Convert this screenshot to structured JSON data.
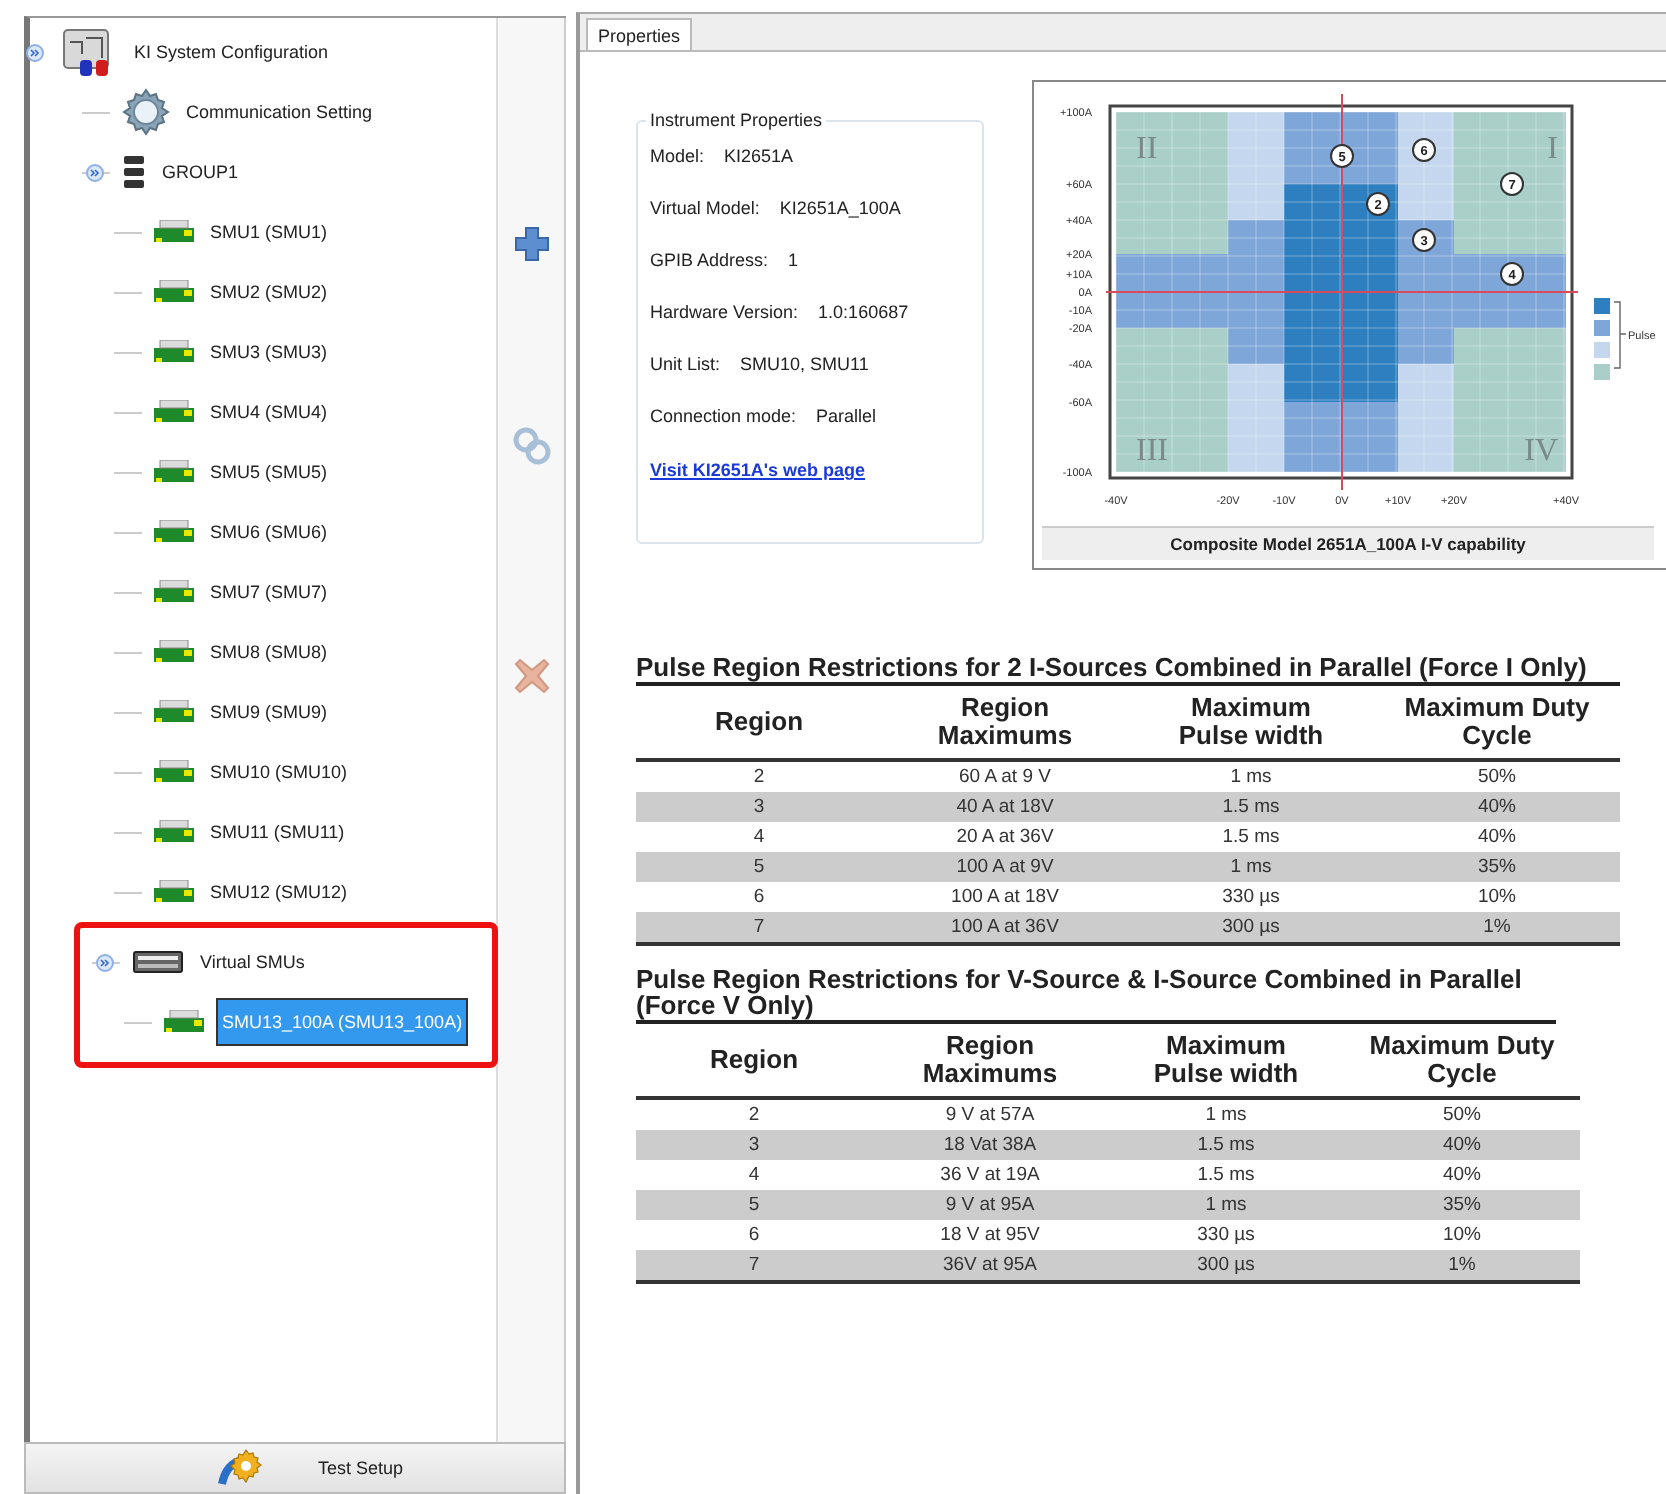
{
  "tree": [
    {
      "label": "KI System Configuration",
      "kind": "system",
      "expanded": true,
      "selected": false,
      "children": [
        {
          "label": "Communication Setting",
          "kind": "gear",
          "selected": false
        },
        {
          "label": "GROUP1",
          "kind": "group",
          "expanded": true,
          "selected": false,
          "children": [
            {
              "label": "SMU1 (SMU1)",
              "kind": "smu",
              "selected": false
            },
            {
              "label": "SMU2 (SMU2)",
              "kind": "smu",
              "selected": false
            },
            {
              "label": "SMU3 (SMU3)",
              "kind": "smu",
              "selected": false
            },
            {
              "label": "SMU4 (SMU4)",
              "kind": "smu",
              "selected": false
            },
            {
              "label": "SMU5 (SMU5)",
              "kind": "smu",
              "selected": false
            },
            {
              "label": "SMU6 (SMU6)",
              "kind": "smu",
              "selected": false
            },
            {
              "label": "SMU7 (SMU7)",
              "kind": "smu",
              "selected": false
            },
            {
              "label": "SMU8 (SMU8)",
              "kind": "smu",
              "selected": false
            },
            {
              "label": "SMU9 (SMU9)",
              "kind": "smu",
              "selected": false
            },
            {
              "label": "SMU10 (SMU10)",
              "kind": "smu",
              "selected": false
            },
            {
              "label": "SMU11 (SMU11)",
              "kind": "smu",
              "selected": false
            },
            {
              "label": "SMU12 (SMU12)",
              "kind": "smu",
              "selected": false
            }
          ]
        },
        {
          "label": "Virtual SMUs",
          "kind": "virtual",
          "expanded": true,
          "selected": false,
          "highlighted": true,
          "children": [
            {
              "label": "SMU13_100A (SMU13_100A)",
              "kind": "smu",
              "selected": true
            }
          ]
        }
      ]
    }
  ],
  "bottom_button": {
    "label": "Test Setup"
  },
  "tabs": [
    {
      "label": "Properties",
      "selected": true
    }
  ],
  "instrument_properties": {
    "title": "Instrument Properties",
    "rows": [
      {
        "label": "Model:",
        "value": "KI2651A"
      },
      {
        "label": "Virtual Model:",
        "value": "KI2651A_100A"
      },
      {
        "label": "GPIB Address:",
        "value": "1"
      },
      {
        "label": "Hardware Version:",
        "value": "1.0:160687"
      },
      {
        "label": "Unit List:",
        "value": "SMU10, SMU11"
      },
      {
        "label": "Connection mode:",
        "value": "Parallel"
      }
    ],
    "link": "Visit KI2651A's web page"
  },
  "iv_chart": {
    "caption": "Composite Model 2651A_100A I-V capability",
    "y_tick_labels": [
      "+100A",
      "+60A",
      "+40A",
      "+20A",
      "+10A",
      "0A",
      "-10A",
      "-20A",
      "-40A",
      "-60A",
      "-100A"
    ],
    "x_tick_labels": [
      "-40V",
      "-20V",
      "-10V",
      "0V",
      "+10V",
      "+20V",
      "+40V"
    ],
    "quadrant_labels": [
      "II",
      "I",
      "III",
      "IV"
    ],
    "region_markers": [
      "5",
      "6",
      "2",
      "7",
      "3",
      "4"
    ],
    "legend": {
      "label": "Pulse",
      "swatches": [
        {
          "color": "#2e7fc0"
        },
        {
          "color": "#7ea6d8"
        },
        {
          "color": "#c4d7ee"
        },
        {
          "color": "#a9cfc8"
        }
      ]
    }
  },
  "tables": [
    {
      "title": "Pulse Region Restrictions for 2 I-Sources Combined in Parallel (Force I Only)",
      "columns": [
        "Region",
        "Region Maximums",
        "Maximum Pulse width",
        "Maximum Duty Cycle"
      ],
      "rows": [
        [
          "2",
          "60 A at 9 V",
          "1 ms",
          "50%"
        ],
        [
          "3",
          "40 A at 18V",
          "1.5 ms",
          "40%"
        ],
        [
          "4",
          "20 A at 36V",
          "1.5 ms",
          "40%"
        ],
        [
          "5",
          "100 A at 9V",
          "1 ms",
          "35%"
        ],
        [
          "6",
          "100 A at 18V",
          "330  µs",
          "10%"
        ],
        [
          "7",
          "100 A at 36V",
          "300 µs",
          "1%"
        ]
      ]
    },
    {
      "title": "Pulse Region Restrictions for V-Source & I-Source Combined in Parallel (Force V Only)",
      "columns": [
        "Region",
        "Region Maximums",
        "Maximum Pulse width",
        "Maximum Duty Cycle"
      ],
      "rows": [
        [
          "2",
          "9 V at 57A",
          "1 ms",
          "50%"
        ],
        [
          "3",
          "18 Vat 38A",
          "1.5 ms",
          "40%"
        ],
        [
          "4",
          "36 V at 19A",
          "1.5 ms",
          "40%"
        ],
        [
          "5",
          "9 V at 95A",
          "1 ms",
          "35%"
        ],
        [
          "6",
          "18 V at 95V",
          "330  µs",
          "10%"
        ],
        [
          "7",
          "36V at 95A",
          "300 µs",
          "1%"
        ]
      ]
    }
  ]
}
